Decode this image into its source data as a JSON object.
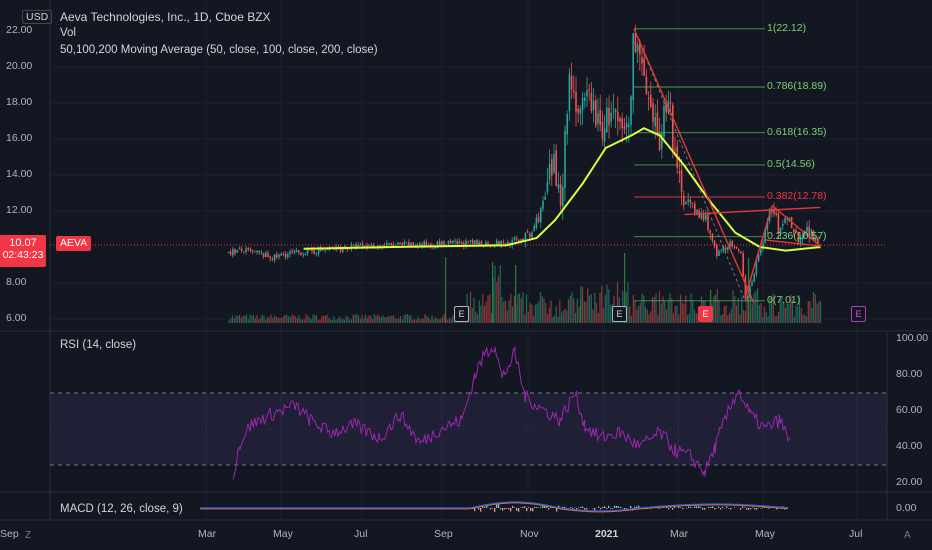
{
  "header": {
    "currency": "USD",
    "symbol_line": "Aeva Technologies, Inc., 1D, Cboe BZX",
    "vol_label": "Vol",
    "ma_label": "50,100,200 Moving Average (50, close, 100, close, 200, close)"
  },
  "price_axis": {
    "ticks": [
      "22.00",
      "20.00",
      "18.00",
      "16.00",
      "14.00",
      "12.00",
      "10.00",
      "8.00",
      "6.00"
    ],
    "last_price": "10.07",
    "countdown": "02:43:23",
    "ticker_tag": "AEVA"
  },
  "fib_labels": [
    "1(22.12)",
    "0.786(18.89)",
    "0.618(16.35)",
    "0.5(14.56)",
    "0.382(12.78)",
    "0.236(10.57)",
    "0(7.01)"
  ],
  "earnings_badges": [
    "E",
    "E",
    "E",
    "E"
  ],
  "rsi": {
    "label": "RSI (14, close)",
    "ticks": [
      "100.00",
      "80.00",
      "60.00",
      "40.00",
      "20.00"
    ]
  },
  "macd": {
    "label": "MACD (12, 26, close, 9)",
    "ticks": [
      "0.00"
    ]
  },
  "time_axis": [
    "Mar",
    "May",
    "Jul",
    "Sep",
    "Nov",
    "2021",
    "Mar",
    "May",
    "Jul",
    "Sep"
  ],
  "footer": {
    "left_button": "Z",
    "right_button": "A"
  },
  "colors": {
    "background": "#131722",
    "up": "#26a69a",
    "down": "#ef5350",
    "ma": "#d6ff3f",
    "rsi": "#9c27b0",
    "fib": "#4caf50",
    "fib_red": "#f23645",
    "trend": "#e53935",
    "macd": "#2962ff",
    "signal": "#ff6d00"
  },
  "chart_data": {
    "type": "candlestick",
    "title": "Aeva Technologies, Inc., 1D, Cboe BZX",
    "ylabel": "USD",
    "ylim": [
      5.5,
      22.5
    ],
    "price_path": [
      [
        "2020-03-20",
        9.75
      ],
      [
        "2020-04-01",
        9.8
      ],
      [
        "2020-04-15",
        9.6
      ],
      [
        "2020-04-25",
        9.4
      ],
      [
        "2020-05-05",
        9.6
      ],
      [
        "2020-06-01",
        9.8
      ],
      [
        "2020-07-01",
        10.0
      ],
      [
        "2020-08-01",
        10.1
      ],
      [
        "2020-09-01",
        10.15
      ],
      [
        "2020-10-01",
        10.2
      ],
      [
        "2020-11-01",
        10.2
      ],
      [
        "2020-11-20",
        10.6
      ],
      [
        "2020-12-01",
        12.5
      ],
      [
        "2020-12-08",
        14.5
      ],
      [
        "2020-12-15",
        13.0
      ],
      [
        "2020-12-22",
        19.8
      ],
      [
        "2020-12-30",
        17.0
      ],
      [
        "2021-01-07",
        18.5
      ],
      [
        "2021-01-15",
        16.5
      ],
      [
        "2021-01-25",
        17.5
      ],
      [
        "2021-02-01",
        16.2
      ],
      [
        "2021-02-08",
        16.8
      ],
      [
        "2021-02-12",
        22.12
      ],
      [
        "2021-02-18",
        20.0
      ],
      [
        "2021-02-25",
        17.0
      ],
      [
        "2021-03-05",
        16.0
      ],
      [
        "2021-03-12",
        18.9
      ],
      [
        "2021-03-18",
        14.0
      ],
      [
        "2021-03-25",
        13.0
      ],
      [
        "2021-04-01",
        12.0
      ],
      [
        "2021-04-12",
        11.5
      ],
      [
        "2021-04-20",
        9.5
      ],
      [
        "2021-04-30",
        10.2
      ],
      [
        "2021-05-10",
        9.5
      ],
      [
        "2021-05-13",
        7.01
      ],
      [
        "2021-05-20",
        8.5
      ],
      [
        "2021-05-28",
        10.5
      ],
      [
        "2021-06-04",
        12.3
      ],
      [
        "2021-06-10",
        10.8
      ],
      [
        "2021-06-17",
        11.8
      ],
      [
        "2021-06-24",
        10.5
      ],
      [
        "2021-07-01",
        11.0
      ],
      [
        "2021-07-08",
        10.6
      ],
      [
        "2021-07-13",
        10.07
      ]
    ],
    "ma50": [
      [
        "2020-05-20",
        9.9
      ],
      [
        "2020-08-01",
        10.0
      ],
      [
        "2020-11-01",
        10.1
      ],
      [
        "2020-11-25",
        10.5
      ],
      [
        "2020-12-10",
        11.5
      ],
      [
        "2021-01-01",
        13.5
      ],
      [
        "2021-01-20",
        15.5
      ],
      [
        "2021-02-10",
        16.2
      ],
      [
        "2021-02-20",
        16.6
      ],
      [
        "2021-03-05",
        16.2
      ],
      [
        "2021-03-25",
        14.5
      ],
      [
        "2021-04-15",
        12.5
      ],
      [
        "2021-05-05",
        10.8
      ],
      [
        "2021-05-25",
        10.0
      ],
      [
        "2021-06-15",
        9.8
      ],
      [
        "2021-07-13",
        10.0
      ]
    ],
    "fibonacci": [
      {
        "level": "1",
        "value": 22.12
      },
      {
        "level": "0.786",
        "value": 18.89
      },
      {
        "level": "0.618",
        "value": 16.35
      },
      {
        "level": "0.5",
        "value": 14.56
      },
      {
        "level": "0.382",
        "value": 12.78
      },
      {
        "level": "0.236",
        "value": 10.57
      },
      {
        "level": "0",
        "value": 7.01
      }
    ],
    "rsi_range": [
      0,
      100
    ],
    "rsi_bands": [
      30,
      70
    ]
  }
}
